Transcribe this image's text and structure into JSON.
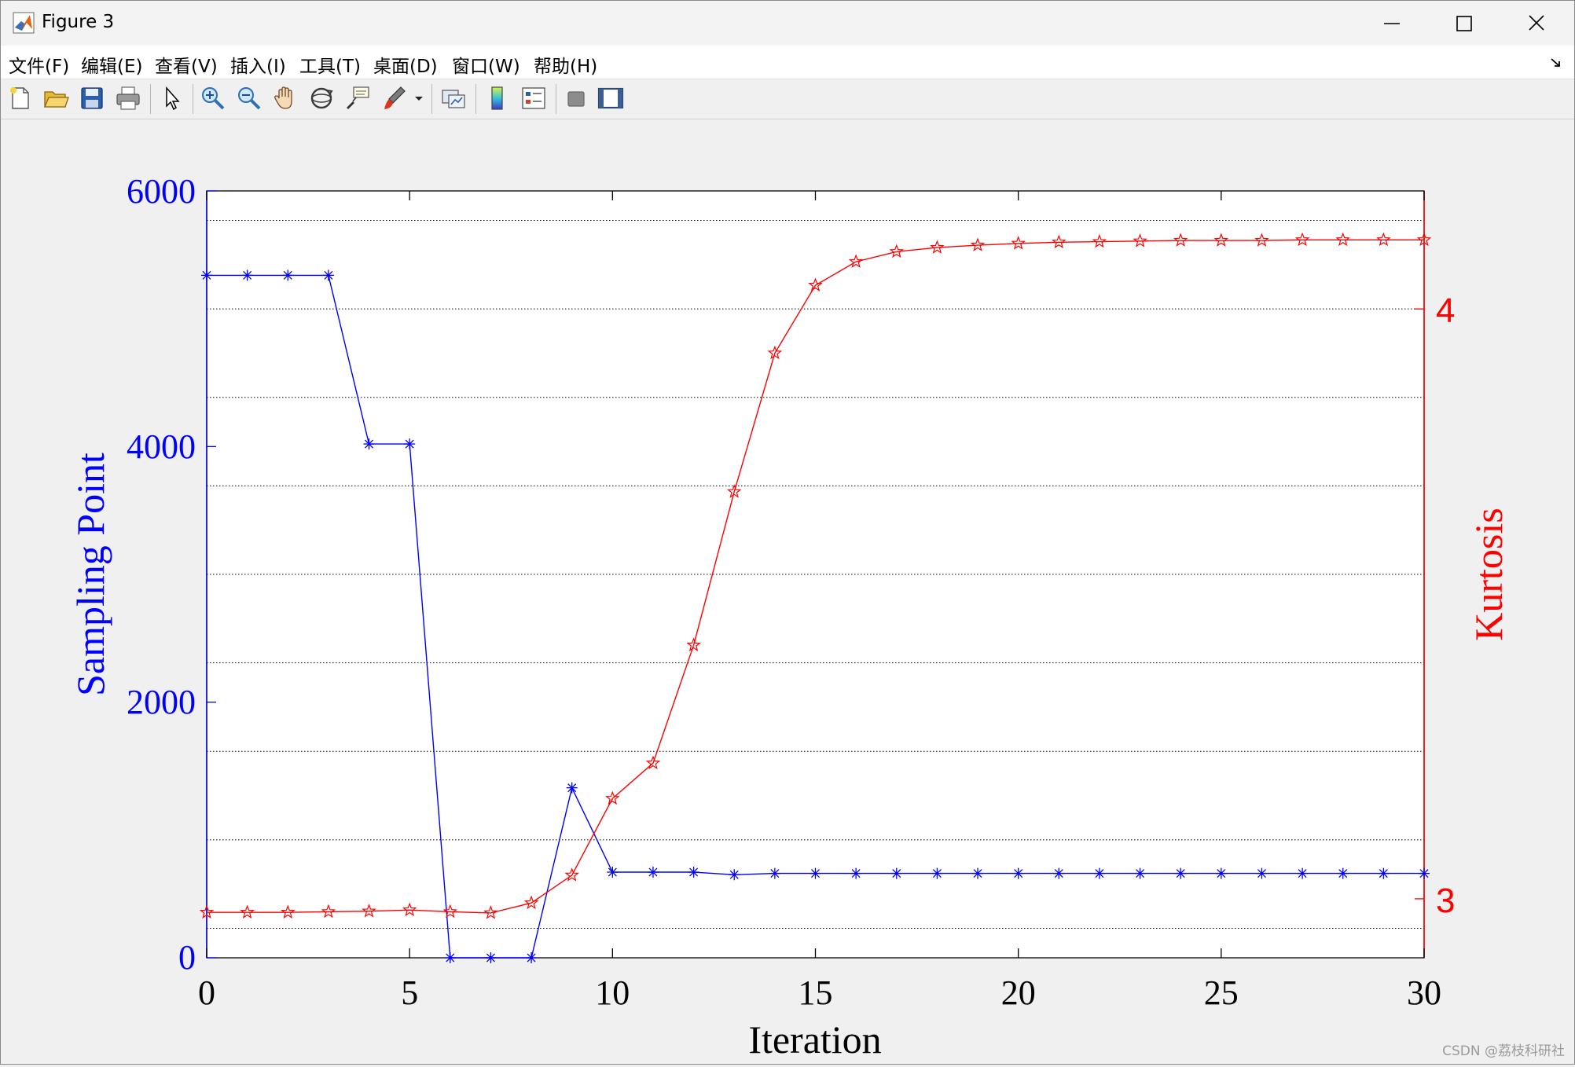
{
  "window": {
    "title": "Figure 3"
  },
  "menu": [
    "文件(F)",
    "编辑(E)",
    "查看(V)",
    "插入(I)",
    "工具(T)",
    "桌面(D)",
    "窗口(W)",
    "帮助(H)"
  ],
  "toolbar": {
    "icons": [
      "new-figure-icon",
      "open-file-icon",
      "save-icon",
      "print-icon",
      "pointer-icon",
      "zoom-in-icon",
      "zoom-out-icon",
      "pan-hand-icon",
      "rotate-3d-icon",
      "data-cursor-icon",
      "brush-icon",
      "brush-dropdown-icon",
      "link-plot-icon",
      "colorbar-icon",
      "legend-icon",
      "hide-plot-tools-icon",
      "show-plot-tools-icon"
    ]
  },
  "colors": {
    "left_axis": "#0000ff",
    "right_axis": "#ff0000",
    "grid": "#000000"
  },
  "chart_data": {
    "type": "line",
    "xlabel": "Iteration",
    "ylabel_left": "Sampling Point",
    "ylabel_right": "Kurtosis",
    "xlim": [
      0,
      30
    ],
    "ylim_left": [
      0,
      6000
    ],
    "ylim_right": [
      2.9,
      4.2
    ],
    "x_ticks": [
      "0",
      "5",
      "10",
      "15",
      "20",
      "25",
      "30"
    ],
    "y_ticks_left": [
      "0",
      "2000",
      "4000",
      "6000"
    ],
    "y_ticks_right": [
      "3",
      "4"
    ],
    "grid": "horizontal dotted, right axis",
    "x": [
      0,
      1,
      2,
      3,
      4,
      5,
      6,
      7,
      8,
      9,
      10,
      11,
      12,
      13,
      14,
      15,
      16,
      17,
      18,
      19,
      20,
      21,
      22,
      23,
      24,
      25,
      26,
      27,
      28,
      29,
      30
    ],
    "series": [
      {
        "axis": "left",
        "marker": "asterisk",
        "values": [
          5340,
          5340,
          5340,
          5340,
          4020,
          4020,
          0,
          0,
          0,
          1330,
          670,
          670,
          670,
          650,
          660,
          660,
          660,
          660,
          660,
          660,
          660,
          660,
          660,
          660,
          660,
          660,
          660,
          660,
          660,
          660,
          660
        ]
      },
      {
        "axis": "right",
        "marker": "pentagram",
        "values": [
          2.977,
          2.977,
          2.977,
          2.978,
          2.979,
          2.981,
          2.978,
          2.976,
          2.993,
          3.04,
          3.17,
          3.23,
          3.43,
          3.69,
          3.925,
          4.04,
          4.08,
          4.097,
          4.104,
          4.108,
          4.111,
          4.113,
          4.114,
          4.115,
          4.116,
          4.116,
          4.116,
          4.117,
          4.117,
          4.117,
          4.117
        ]
      }
    ]
  },
  "watermark": "CSDN @荔枝科研社"
}
